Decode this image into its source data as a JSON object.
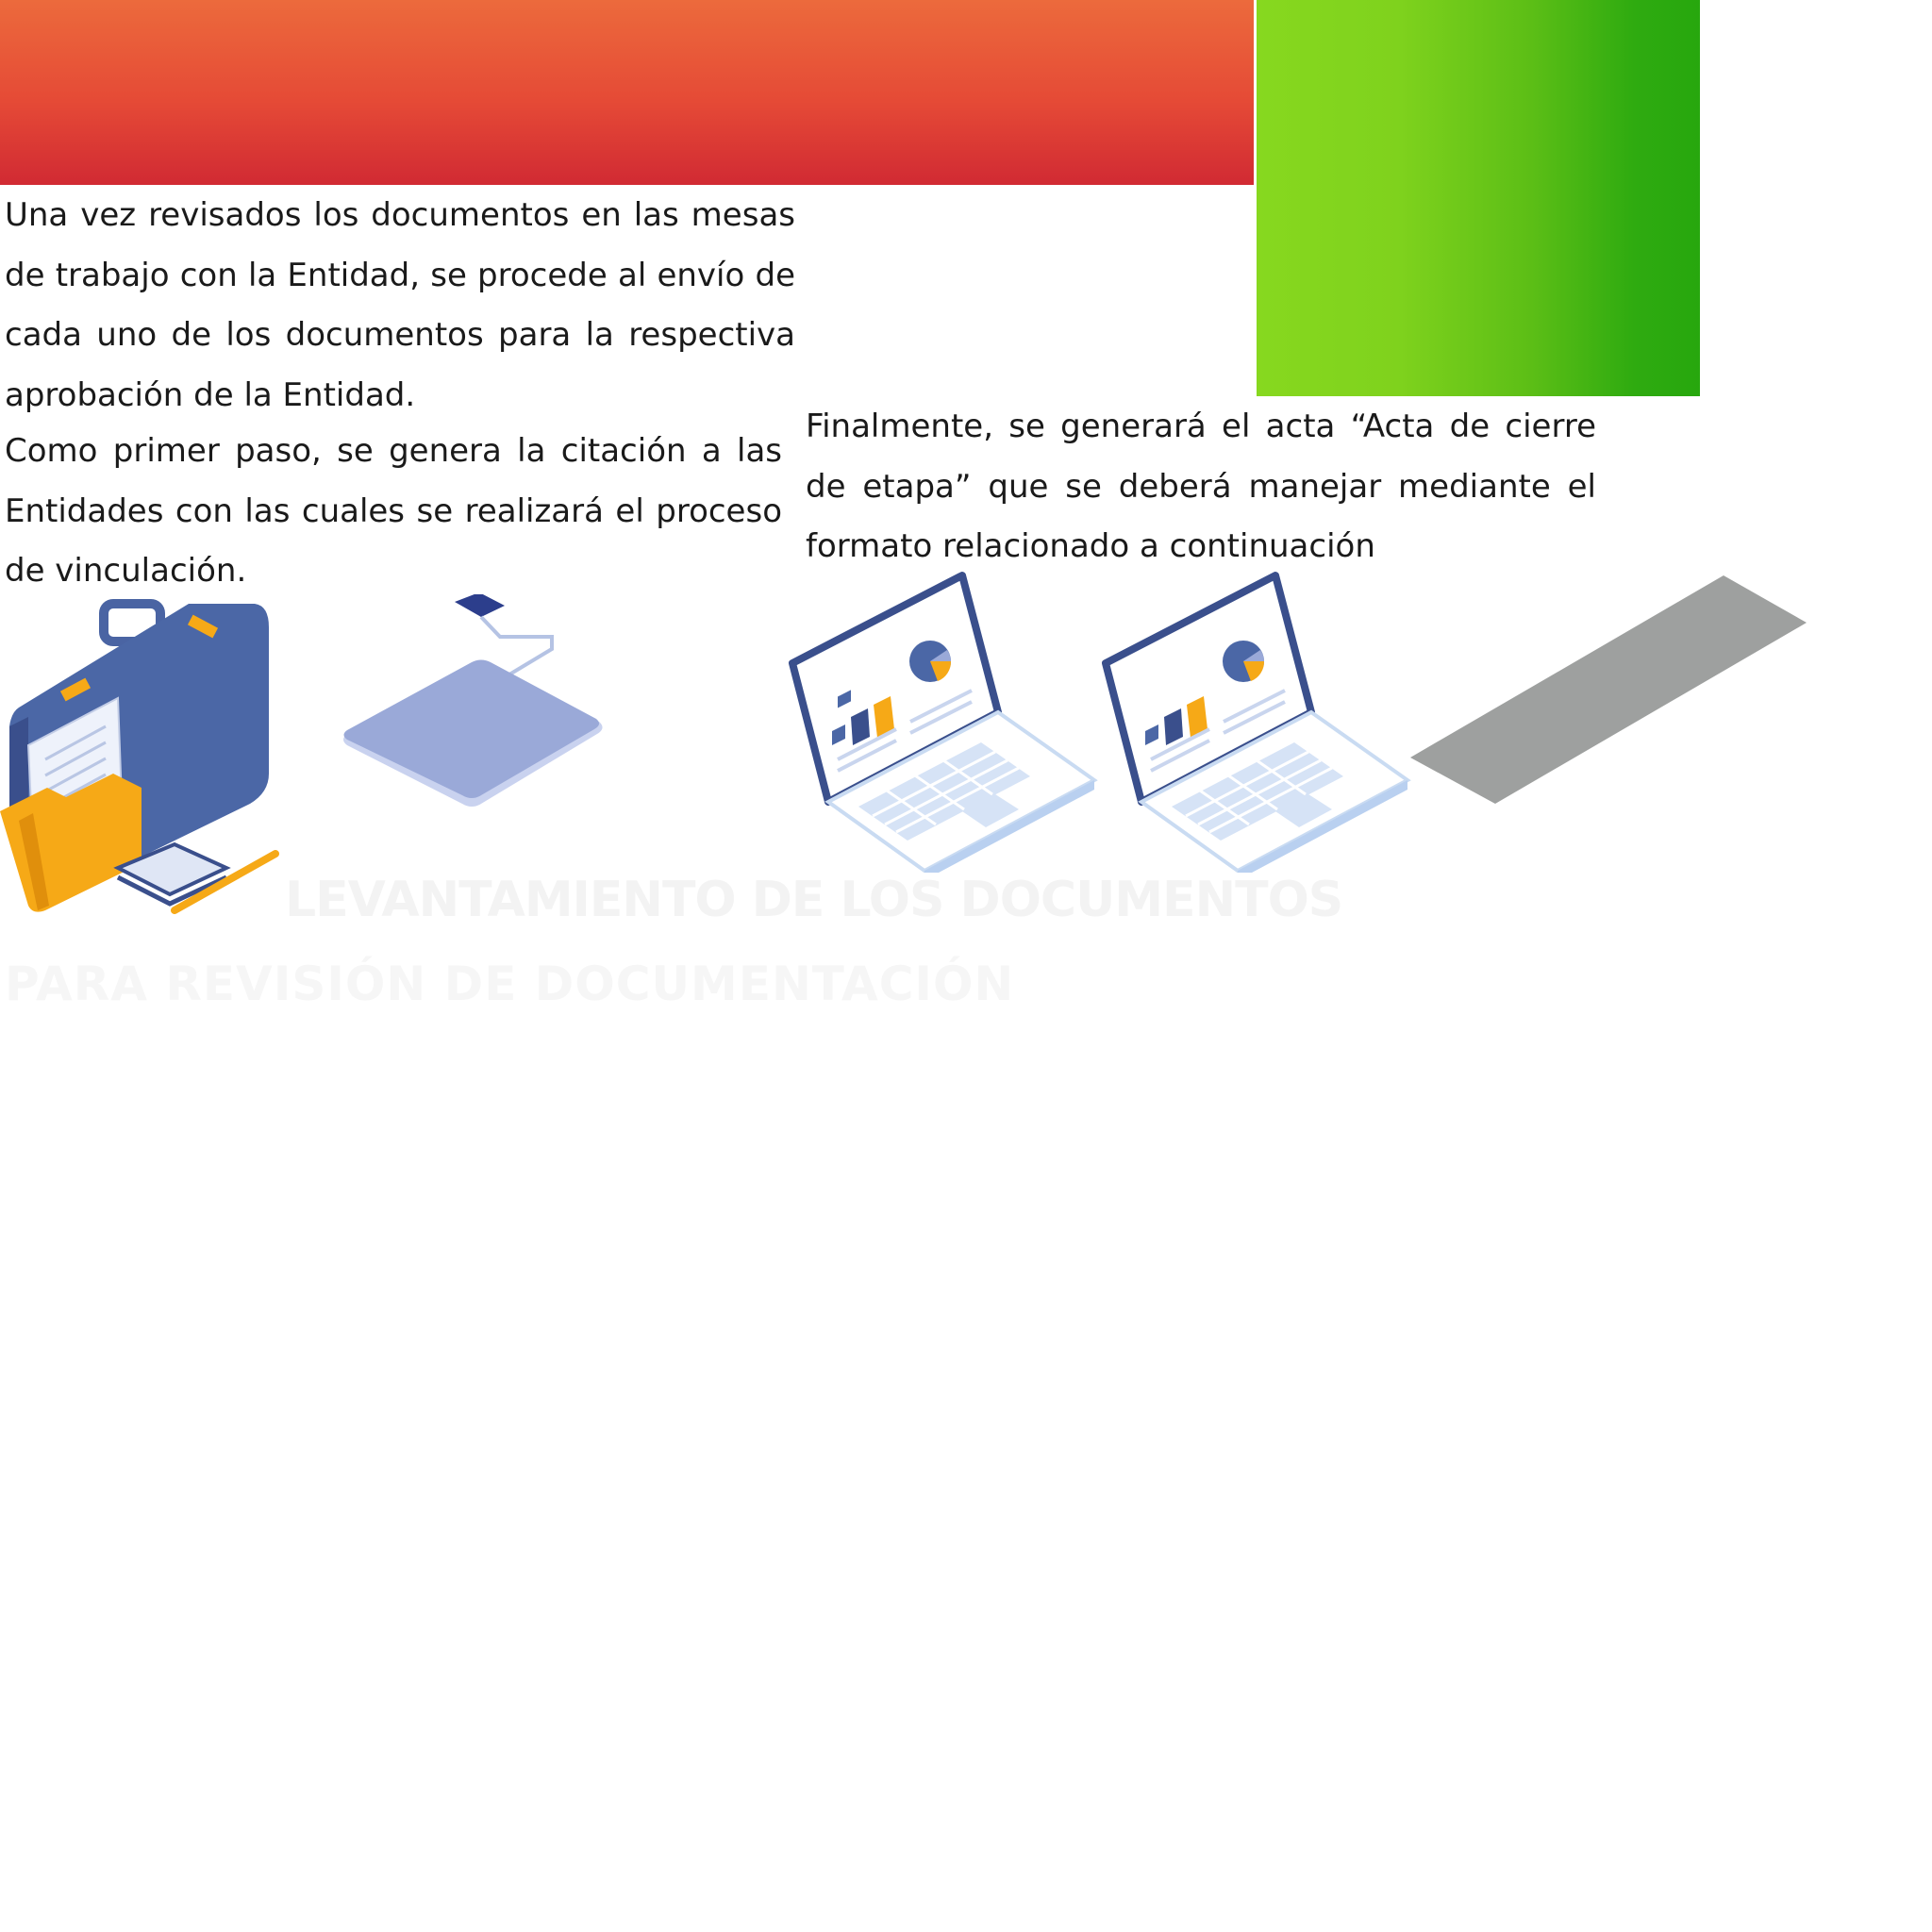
{
  "document": {
    "paragraphs": [
      "Una vez revisados los documentos en las mesas de trabajo con la Entidad, se procede al envío de cada uno de los documentos para la respectiva aprobación de la Entidad.",
      "Como primer paso, se genera la citación a las Entidades con las cuales se realizará el proceso de vinculación.",
      "Finalmente, se generará el acta “Acta de cierre de etapa” que se deberá manejar mediante el formato relacionado a continuación"
    ],
    "heading_title": "LEVANTAMIENTO DE LOS DOCUMENTOS",
    "heading_subtitle": "PARA REVISIÓN DE DOCUMENTACIÓN"
  },
  "illustrations": [
    {
      "icon": "briefcase-folder-icon"
    },
    {
      "icon": "tablet-pad-icon"
    },
    {
      "icon": "laptop-chart-icon"
    },
    {
      "icon": "laptop-chart-icon"
    },
    {
      "icon": "gray-isometric-panel-icon"
    }
  ],
  "colors": {
    "header_gradient_top": "#ec6a3c",
    "header_gradient_bottom": "#d12a33",
    "green_panel_light": "#87d81f",
    "green_panel_dark": "#27a70e",
    "illustration_navy": "#3a4f8c",
    "illustration_orange": "#f6a917",
    "illustration_lavender": "#9aa9d8",
    "gray_panel": "#9ea09f"
  }
}
